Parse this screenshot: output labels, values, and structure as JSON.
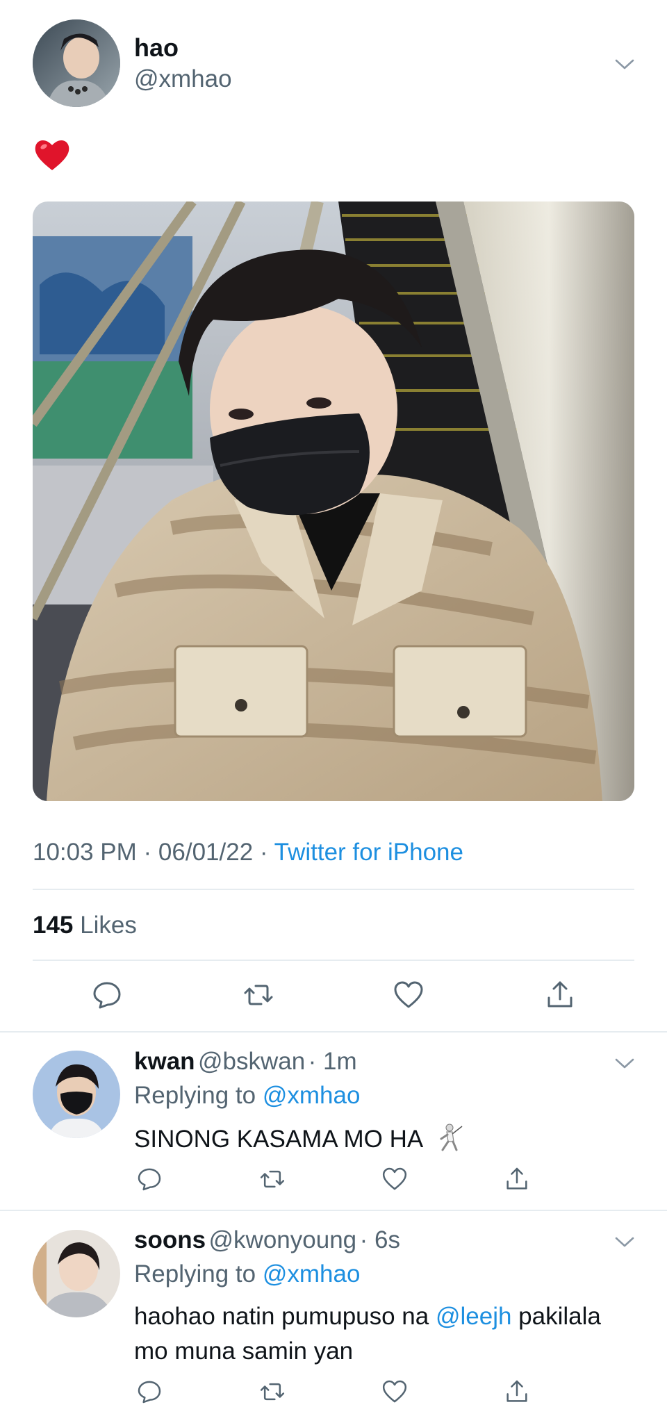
{
  "tweet": {
    "author": {
      "name": "hao",
      "handle": "@xmhao"
    },
    "text": "❤️",
    "timestamp": "10:03 PM · 06/01/22 · ",
    "source": "Twitter for iPhone",
    "likes_count": "145",
    "likes_label": "Likes"
  },
  "replies": [
    {
      "name": "kwan",
      "handle": "@bskwan",
      "time": "· 1m",
      "replying_label": "Replying to",
      "replying_to": "@xmhao",
      "text": "SINONG KASAMA MO HA",
      "emoji": "🤺"
    },
    {
      "name": "soons",
      "handle": "@kwonyoung",
      "time": "· 6s",
      "replying_label": "Replying to",
      "replying_to": "@xmhao",
      "text_before": "haohao natin pumupuso na ",
      "mention": "@leejh",
      "text_after": " pakilala mo muna samin yan"
    }
  ],
  "colors": {
    "link": "#1d8fe0",
    "muted": "#536471",
    "heart": "#e0142b",
    "divider": "#e6ecf0"
  },
  "icons": [
    "chevron-down-icon",
    "reply-icon",
    "retweet-icon",
    "like-icon",
    "share-icon"
  ]
}
